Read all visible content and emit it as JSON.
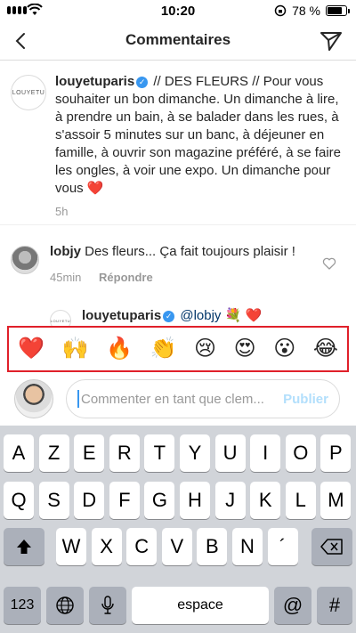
{
  "status": {
    "time": "10:20",
    "battery": "78 %",
    "battery_level": 0.78
  },
  "nav": {
    "title": "Commentaires"
  },
  "post": {
    "avatar_text": "LOUYETU",
    "username": "louyetuparis",
    "text": " // DES FLEURS // Pour vous souhaiter un bon dimanche. Un dimanche à lire, à prendre un bain, à se balader dans les rues, à s'assoir 5 minutes sur un banc, à déjeuner en famille, à ouvrir son magazine préféré, à se faire les ongles, à voir une expo. Un dimanche pour vous ",
    "heart": "❤️",
    "time": "5h"
  },
  "comment": {
    "username": "lobjy",
    "text": " Des fleurs... Ça fait toujours plaisir !",
    "time": "45min",
    "reply": "Répondre"
  },
  "reply": {
    "avatar_text": "LOUYETU",
    "username": "louyetuparis",
    "mention": "@lobjy",
    "emojis": " 💐 ❤️"
  },
  "emoji_bar": [
    "❤️",
    "🙌",
    "🔥",
    "👏",
    "😢",
    "😍",
    "😮",
    "😂"
  ],
  "input": {
    "placeholder": "Commenter en tant que clem...",
    "publish": "Publier"
  },
  "keyboard": {
    "row1": [
      "A",
      "Z",
      "E",
      "R",
      "T",
      "Y",
      "U",
      "I",
      "O",
      "P"
    ],
    "row2": [
      "Q",
      "S",
      "D",
      "F",
      "G",
      "H",
      "J",
      "K",
      "L",
      "M"
    ],
    "row3": [
      "W",
      "X",
      "C",
      "V",
      "B",
      "N",
      "´"
    ],
    "numbers": "123",
    "space": "espace",
    "at": "@",
    "hash": "#"
  }
}
